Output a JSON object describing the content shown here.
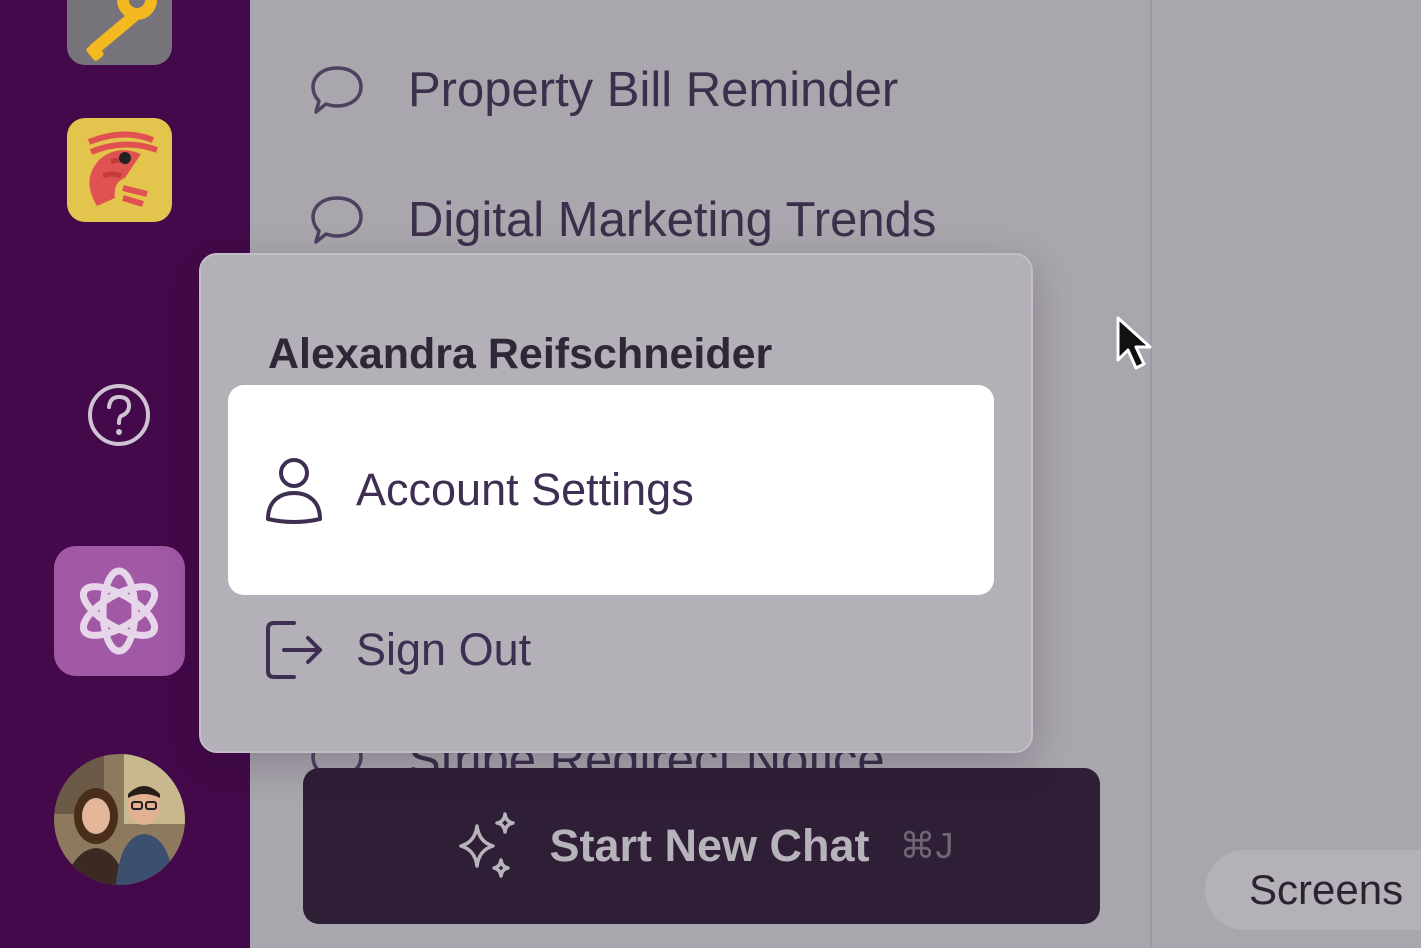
{
  "sidebar": {
    "apps": [
      {
        "name": "key-app",
        "icon": "key-icon"
      },
      {
        "name": "shrimp-app",
        "icon": "shrimp-icon"
      },
      {
        "name": "ai-chat-app",
        "icon": "openai-knot-icon"
      }
    ],
    "help_icon": "question-circle-icon",
    "avatar": "user-avatar-photo"
  },
  "chat_list": {
    "items": [
      {
        "title": "Property Bill Reminder",
        "icon": "chat-bubble-icon"
      },
      {
        "title": "Digital Marketing Trends",
        "icon": "chat-bubble-icon"
      },
      {
        "title": "Stripe Redirect Notice",
        "icon": "chat-bubble-icon"
      }
    ],
    "start_button": {
      "label": "Start New Chat",
      "shortcut": "⌘J",
      "icon": "sparkles-icon"
    }
  },
  "account_menu": {
    "user_name": "Alexandra Reifschneider",
    "items": [
      {
        "label": "Account Settings",
        "icon": "user-icon",
        "highlighted": true
      },
      {
        "label": "Sign Out",
        "icon": "sign-out-icon",
        "highlighted": false
      }
    ]
  },
  "right_pane": {
    "screens_button": "Screens"
  },
  "colors": {
    "sidebar": "#43094a",
    "overlay": "#a9a6ad",
    "start_button": "#2f1f36",
    "highlight": "#ffffff",
    "accent_tile": "#a159a6"
  }
}
